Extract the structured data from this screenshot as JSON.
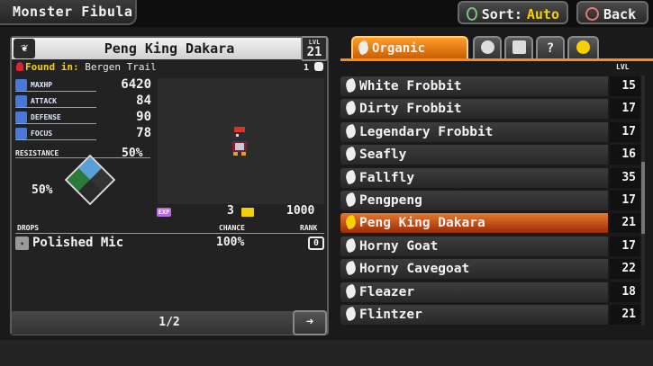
{
  "header": {
    "title": "Monster Fibula"
  },
  "buttons": {
    "sort_label": "Sort:",
    "sort_value": "Auto",
    "back_label": "Back",
    "sort_icon": "triangle-button-icon",
    "back_icon": "circle-button-icon"
  },
  "monster": {
    "name": "Peng King Dakara",
    "level_label": "LVL",
    "level": "21",
    "found_label": "Found in:",
    "found_location": "Bergen Trail",
    "count": "1",
    "stats": [
      {
        "label": "MAXHP",
        "value": "6420"
      },
      {
        "label": "ATTACK",
        "value": "84"
      },
      {
        "label": "DEFENSE",
        "value": "90"
      },
      {
        "label": "FOCUS",
        "value": "78"
      }
    ],
    "resistance_label": "RESISTANCE",
    "resistance_right": "50%",
    "resistance_left": "50%",
    "exp_label": "EXP",
    "drop_count": "3",
    "exp_value": "1000"
  },
  "drops": {
    "header_drops": "DROPS",
    "header_chance": "CHANCE",
    "header_rank": "RANK",
    "items": [
      {
        "name": "Polished Mic",
        "chance": "100%",
        "rank": "0"
      }
    ]
  },
  "pager": {
    "text": "1/2"
  },
  "tabs": [
    {
      "label": "Organic",
      "active": true
    },
    {
      "label": "",
      "icon": "robot-face-icon"
    },
    {
      "label": "",
      "icon": "house-icon"
    },
    {
      "label": "?"
    },
    {
      "label": "",
      "icon": "crown-icon"
    }
  ],
  "list": {
    "lvl_header": "LVL",
    "rows": [
      {
        "name": "White Frobbit",
        "lvl": "15"
      },
      {
        "name": "Dirty Frobbit",
        "lvl": "17"
      },
      {
        "name": "Legendary Frobbit",
        "lvl": "17"
      },
      {
        "name": "Seafly",
        "lvl": "16"
      },
      {
        "name": "Fallfly",
        "lvl": "35"
      },
      {
        "name": "Pengpeng",
        "lvl": "17"
      },
      {
        "name": "Peng King Dakara",
        "lvl": "21",
        "selected": true
      },
      {
        "name": "Horny Goat",
        "lvl": "17"
      },
      {
        "name": "Horny Cavegoat",
        "lvl": "22"
      },
      {
        "name": "Fleazer",
        "lvl": "18"
      },
      {
        "name": "Flintzer",
        "lvl": "21"
      }
    ]
  },
  "colors": {
    "accent": "#ff8c1a",
    "highlight": "#f6d000",
    "stat_blue": "#4a78d8"
  }
}
